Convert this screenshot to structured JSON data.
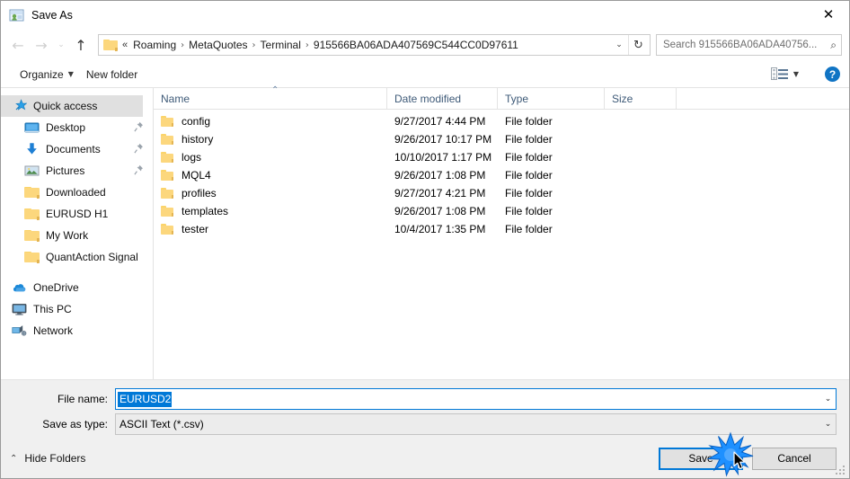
{
  "window": {
    "title": "Save As",
    "title_icon": "save-as-icon",
    "close_label": "✕"
  },
  "nav": {
    "back_icon": "←",
    "forward_icon": "→",
    "recent_icon": "⌄",
    "up_icon": "↑",
    "refresh_icon": "↻",
    "dropdown_icon": "⌄"
  },
  "address": {
    "leading": "«",
    "separator": "›",
    "crumbs": [
      "Roaming",
      "MetaQuotes",
      "Terminal",
      "915566BA06ADA407569C544CC0D97611"
    ]
  },
  "search": {
    "placeholder": "Search 915566BA06ADA40756...",
    "icon": "⌕"
  },
  "toolbar": {
    "organize_label": "Organize",
    "organize_caret": "▼",
    "new_folder_label": "New folder",
    "view_caret": "▼",
    "help_label": "?"
  },
  "sidebar": {
    "items": [
      {
        "label": "Quick access",
        "icon": "star-icon",
        "selected": true,
        "indent": 0,
        "pinned": false
      },
      {
        "label": "Desktop",
        "icon": "desktop-icon",
        "selected": false,
        "indent": 1,
        "pinned": true
      },
      {
        "label": "Documents",
        "icon": "documents-icon",
        "selected": false,
        "indent": 1,
        "pinned": true
      },
      {
        "label": "Pictures",
        "icon": "pictures-icon",
        "selected": false,
        "indent": 1,
        "pinned": true
      },
      {
        "label": "Downloaded",
        "icon": "folder-icon",
        "selected": false,
        "indent": 1,
        "pinned": false
      },
      {
        "label": "EURUSD H1",
        "icon": "folder-icon",
        "selected": false,
        "indent": 1,
        "pinned": false
      },
      {
        "label": "My Work",
        "icon": "folder-icon",
        "selected": false,
        "indent": 1,
        "pinned": false
      },
      {
        "label": "QuantAction Signal",
        "icon": "folder-icon",
        "selected": false,
        "indent": 1,
        "pinned": false
      }
    ],
    "groups": [
      {
        "label": "OneDrive",
        "icon": "onedrive-icon"
      },
      {
        "label": "This PC",
        "icon": "this-pc-icon"
      },
      {
        "label": "Network",
        "icon": "network-icon"
      }
    ]
  },
  "filepane": {
    "columns": [
      "Name",
      "Date modified",
      "Type",
      "Size"
    ],
    "sort_caret": "⌃",
    "rows": [
      {
        "name": "config",
        "date": "9/27/2017 4:44 PM",
        "type": "File folder",
        "size": ""
      },
      {
        "name": "history",
        "date": "9/26/2017 10:17 PM",
        "type": "File folder",
        "size": ""
      },
      {
        "name": "logs",
        "date": "10/10/2017 1:17 PM",
        "type": "File folder",
        "size": ""
      },
      {
        "name": "MQL4",
        "date": "9/26/2017 1:08 PM",
        "type": "File folder",
        "size": ""
      },
      {
        "name": "profiles",
        "date": "9/27/2017 4:21 PM",
        "type": "File folder",
        "size": ""
      },
      {
        "name": "templates",
        "date": "9/26/2017 1:08 PM",
        "type": "File folder",
        "size": ""
      },
      {
        "name": "tester",
        "date": "10/4/2017 1:35 PM",
        "type": "File folder",
        "size": ""
      }
    ]
  },
  "form": {
    "filename_label": "File name:",
    "filename_value": "EURUSD2",
    "savetype_label": "Save as type:",
    "savetype_value": "ASCII Text (*.csv)",
    "dropdown_icon": "⌄"
  },
  "footer": {
    "hide_folders_label": "Hide Folders",
    "hide_folders_caret": "⌃",
    "save_label": "Save",
    "cancel_label": "Cancel"
  },
  "colors": {
    "accent": "#0078d7",
    "folder": "#fcd77d",
    "selection": "#e0e0e0",
    "header_text": "#3e5a78",
    "dialog_bg": "#f0f0f0"
  }
}
